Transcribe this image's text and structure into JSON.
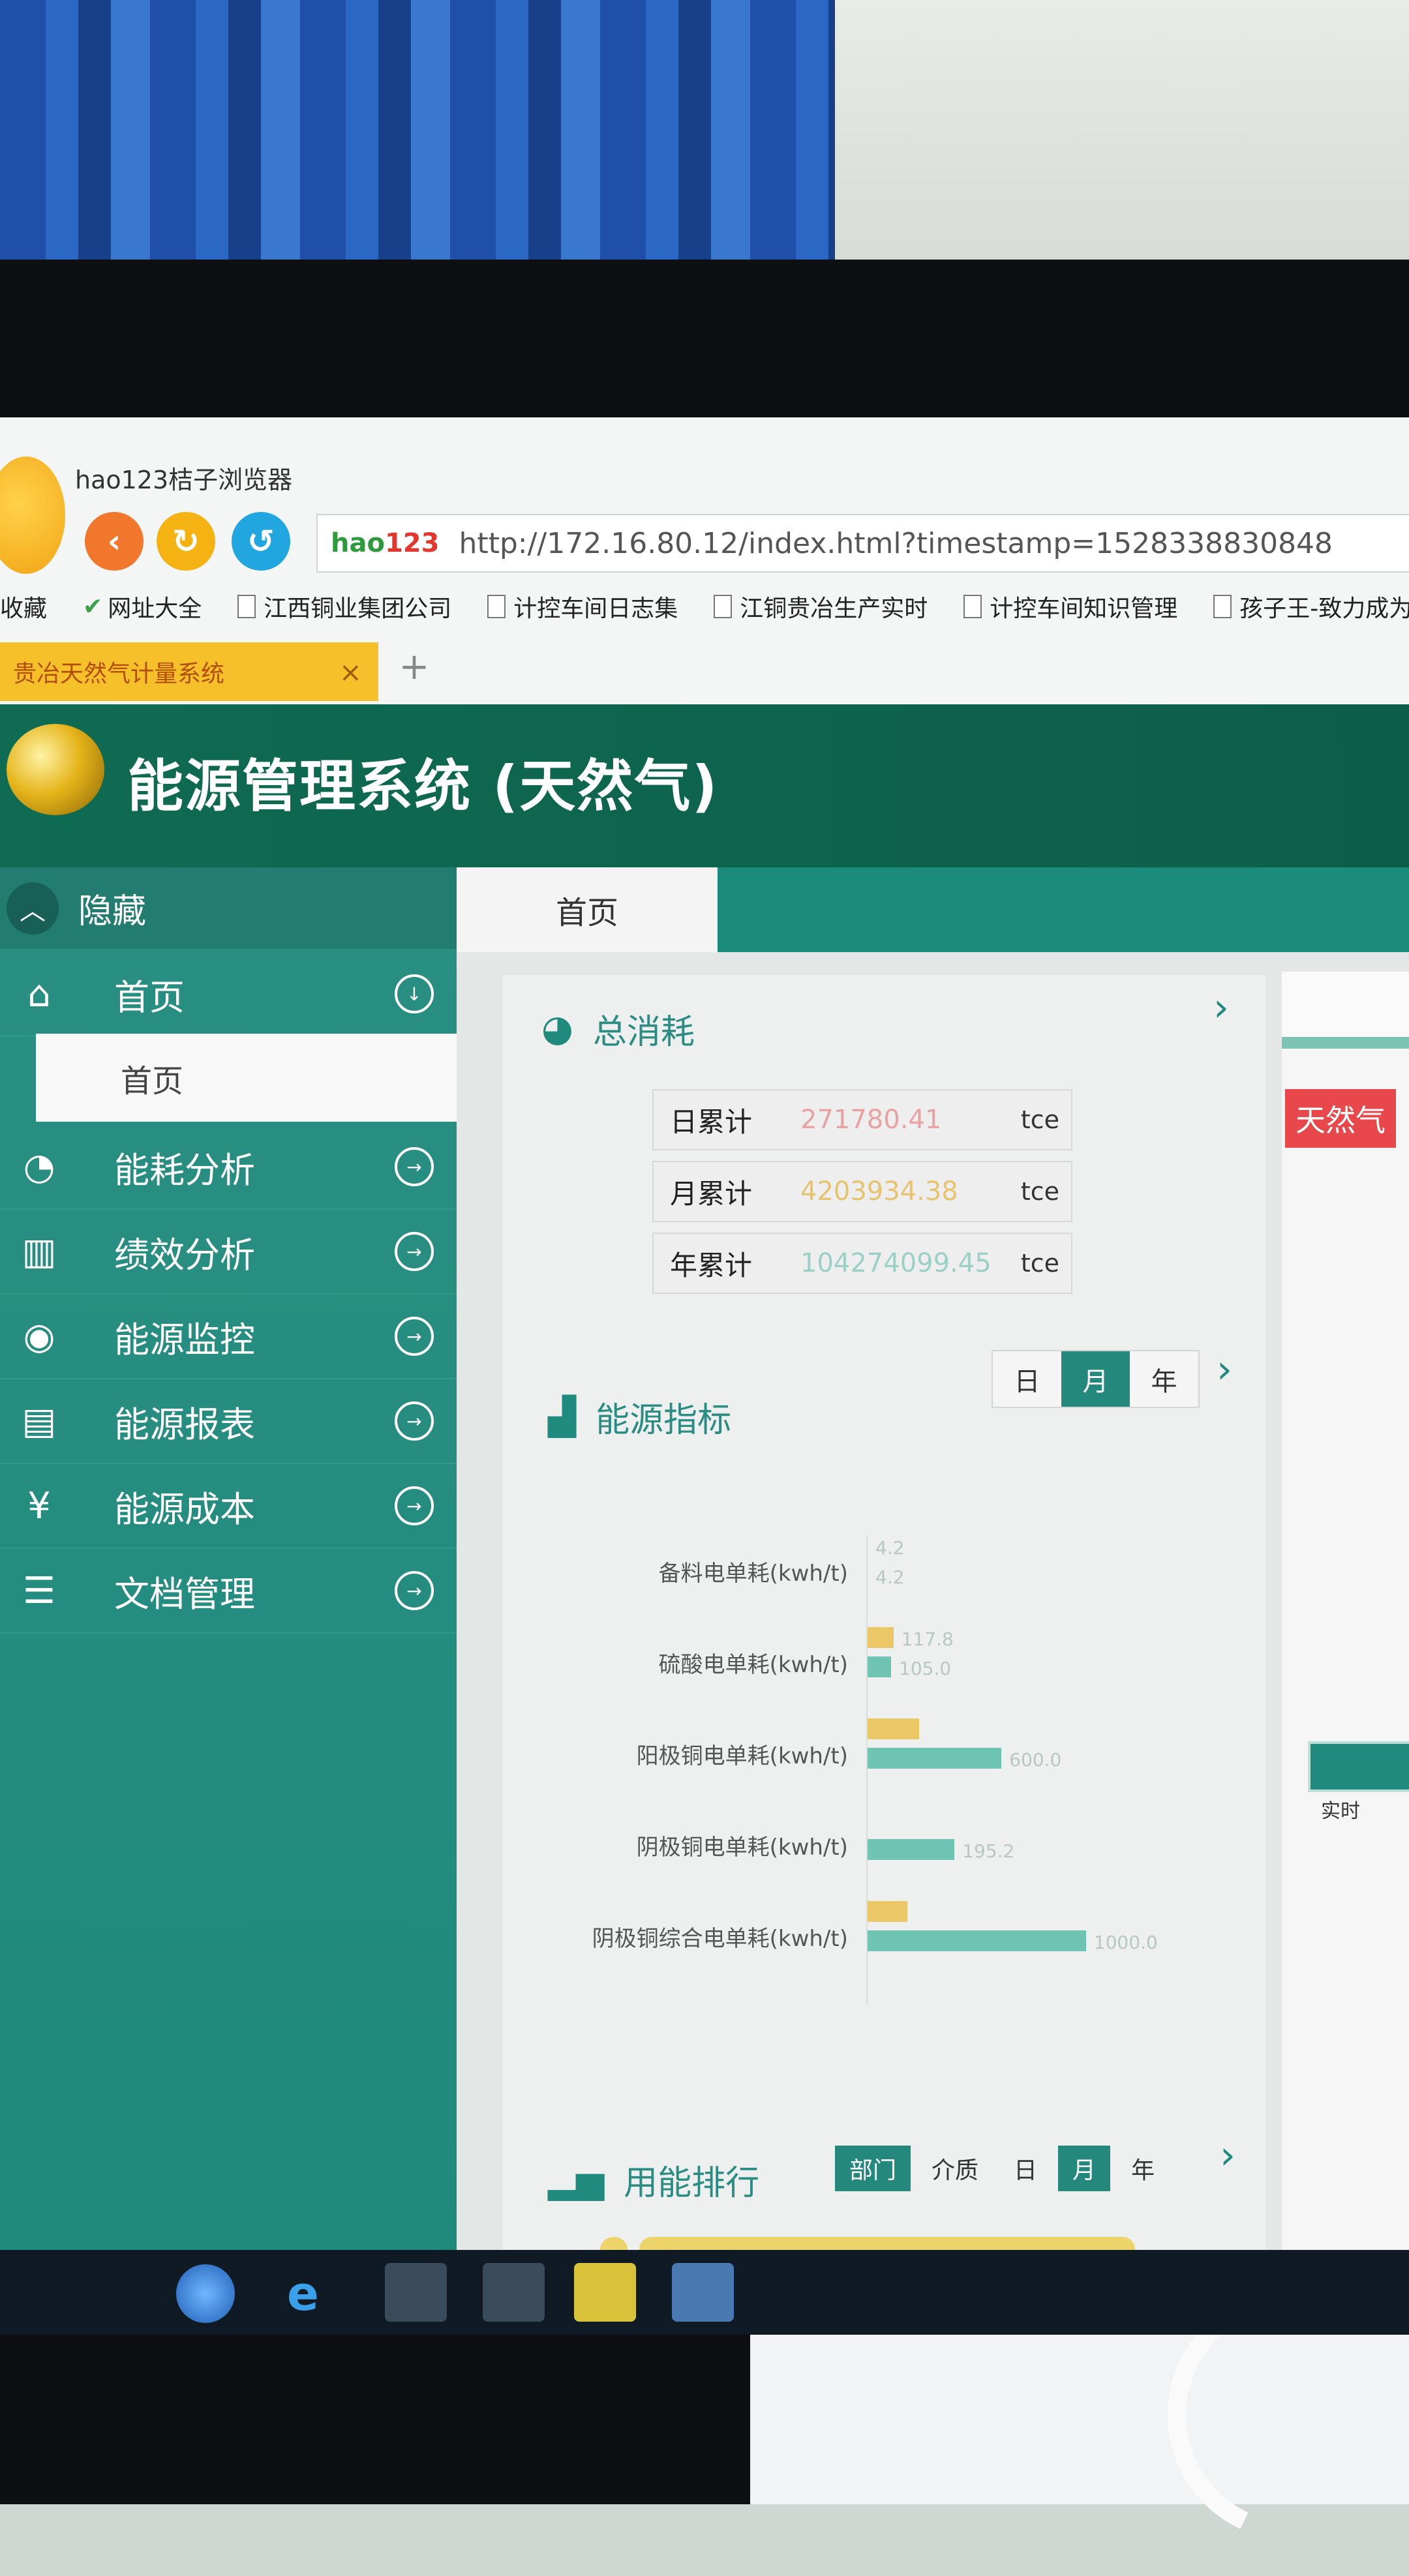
{
  "browser": {
    "title": "hao123桔子浏览器",
    "url": "http://172.16.80.12/index.html?timestamp=1528338830848",
    "site_logo_main": "hao",
    "site_logo_num": "123",
    "bookmarks": [
      "收藏",
      "网址大全",
      "江西铜业集团公司",
      "计控车间日志集",
      "江铜贵冶生产实时",
      "计控车间知识管理",
      "孩子王-致力成为"
    ],
    "tab_title": "贵冶天然气计量系统",
    "tab_new": "+",
    "tab_close": "×"
  },
  "app": {
    "title": "能源管理系统 (天然气)"
  },
  "sidebar": {
    "hide_label": "隐藏",
    "items": [
      {
        "label": "首页",
        "icon": "home-icon"
      },
      {
        "label": "能耗分析",
        "icon": "pie-chart-icon"
      },
      {
        "label": "绩效分析",
        "icon": "bar-chart-icon"
      },
      {
        "label": "能源监控",
        "icon": "eye-icon"
      },
      {
        "label": "能源报表",
        "icon": "report-icon"
      },
      {
        "label": "能源成本",
        "icon": "yen-icon"
      },
      {
        "label": "文档管理",
        "icon": "document-icon"
      }
    ],
    "sub_item": "首页"
  },
  "content": {
    "tab": "首页",
    "total": {
      "title": "总消耗",
      "rows": [
        {
          "label": "日累计",
          "value": "271780.41",
          "unit": "tce",
          "color": "#e9a2a2"
        },
        {
          "label": "月累计",
          "value": "4203934.38",
          "unit": "tce",
          "color": "#e7c36f"
        },
        {
          "label": "年累计",
          "value": "104274099.45",
          "unit": "tce",
          "color": "#9bd1c5"
        }
      ]
    },
    "indicators": {
      "title": "能源指标",
      "toggle": [
        "日",
        "月",
        "年"
      ],
      "active": "月",
      "rows": [
        {
          "label": "备料电单耗(kwh/t)",
          "v1": "4.2",
          "v2": "4.2",
          "p1": 0,
          "p2": 0
        },
        {
          "label": "硫酸电单耗(kwh/t)",
          "v1": "117.8",
          "v2": "105.0",
          "p1": 0.11,
          "p2": 0.1
        },
        {
          "label": "阳极铜电单耗(kwh/t)",
          "v1": "",
          "v2": "600.0",
          "p1": 0.22,
          "p2": 0.57
        },
        {
          "label": "阴极铜电单耗(kwh/t)",
          "v1": "",
          "v2": "195.2",
          "p1": 0,
          "p2": 0.37
        },
        {
          "label": "阴极铜综合电单耗(kwh/t)",
          "v1": "",
          "v2": "1000.0",
          "p1": 0.17,
          "p2": 0.93
        }
      ]
    },
    "ranking": {
      "title": "用能排行",
      "buttons": [
        "部门",
        "介质",
        "日",
        "月",
        "年"
      ],
      "active": [
        "部门",
        "月"
      ]
    }
  },
  "right_panel": {
    "badge": "天然气",
    "chip_label": "实时"
  },
  "colors": {
    "primary": "#1f8a7d",
    "header": "#0f6b52",
    "badge": "#e8484b"
  }
}
